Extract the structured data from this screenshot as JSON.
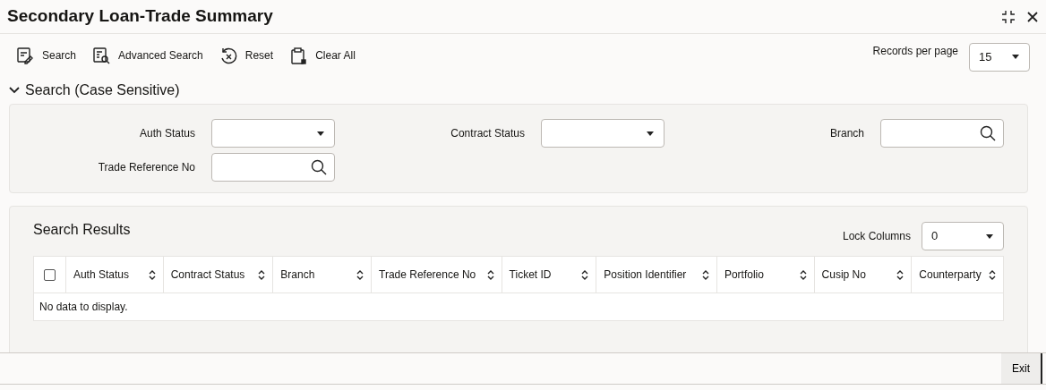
{
  "window": {
    "title": "Secondary Loan-Trade Summary"
  },
  "toolbar": [
    {
      "kind": "search",
      "label": "Search"
    },
    {
      "kind": "advanced",
      "label": "Advanced Search"
    },
    {
      "kind": "reset",
      "label": "Reset"
    },
    {
      "kind": "clear",
      "label": "Clear All"
    }
  ],
  "records_per_page": {
    "label": "Records per page",
    "value": "15"
  },
  "search_section": {
    "title": "Search (Case Sensitive)",
    "expanded": true,
    "fields": [
      {
        "label": "Auth Status",
        "kind": "select"
      },
      {
        "label": "Contract Status",
        "kind": "select"
      },
      {
        "label": "Branch",
        "kind": "lookup"
      },
      {
        "label": "Trade Reference No",
        "kind": "lookup"
      }
    ]
  },
  "results": {
    "title": "Search Results",
    "lock_columns": {
      "label": "Lock Columns",
      "value": "0"
    },
    "select_all": {
      "checked": false
    },
    "columns": [
      "Auth Status",
      "Contract Status",
      "Branch",
      "Trade Reference No",
      "Ticket ID",
      "Position Identifier",
      "Portfolio",
      "Cusip No",
      "Counterparty"
    ],
    "empty_message": "No data to display."
  },
  "footer": {
    "buttons": [
      "Exit"
    ]
  }
}
